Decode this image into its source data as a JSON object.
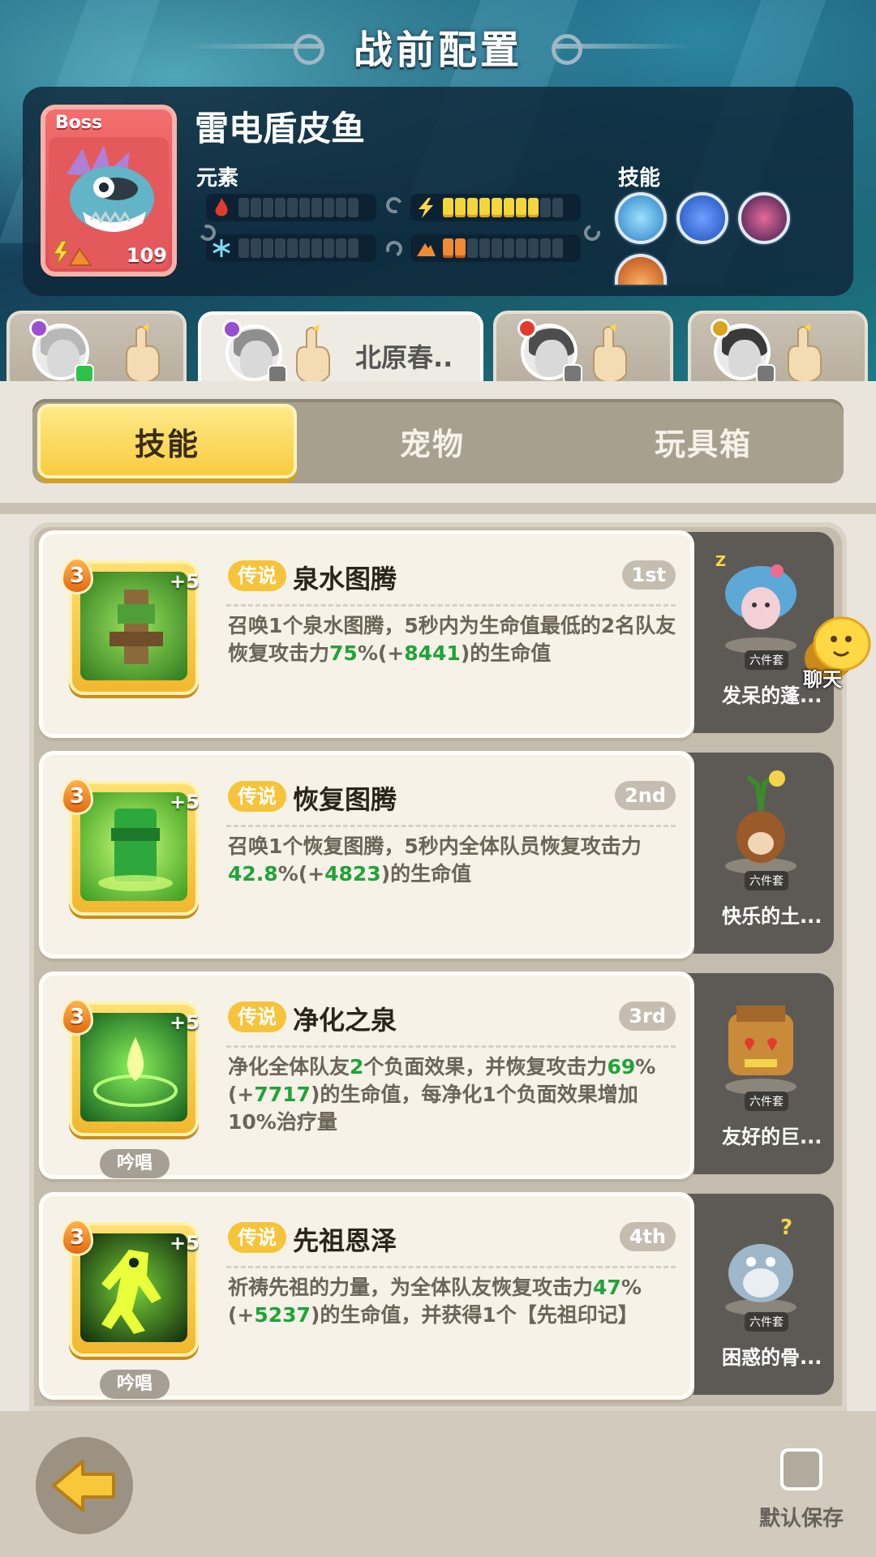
{
  "header": {
    "title": "战前配置"
  },
  "boss": {
    "tag": "Boss",
    "level": "109",
    "name": "雷电盾皮鱼",
    "element_label": "元素",
    "skill_label": "技能",
    "elements": [
      {
        "icon": "fire-icon",
        "filled": 0,
        "total": 10
      },
      {
        "icon": "lightning-icon",
        "filled": 8,
        "total": 10
      },
      {
        "icon": "ice-icon",
        "filled": 0,
        "total": 10
      },
      {
        "icon": "earth-icon",
        "filled": 2,
        "total": 10
      }
    ]
  },
  "char_tabs": [
    {
      "name": "",
      "active": false
    },
    {
      "name": "北原春..",
      "active": true
    },
    {
      "name": "",
      "active": false
    },
    {
      "name": "",
      "active": false
    }
  ],
  "tabs": [
    {
      "label": "技能",
      "active": true
    },
    {
      "label": "宠物",
      "active": false
    },
    {
      "label": "玩具箱",
      "active": false
    }
  ],
  "skills": [
    {
      "level": "3",
      "plus": "+5",
      "rarity": "传说",
      "title": "泉水图腾",
      "order": "1st",
      "desc_parts": [
        "召唤1个泉水图腾，5秒内为生命值最低的2名队友恢复攻击力",
        "75",
        "%(+",
        "8441",
        ")的生命值"
      ],
      "chant": "",
      "pet": {
        "name": "发呆的蓬...",
        "tag": "六件套"
      }
    },
    {
      "level": "3",
      "plus": "+5",
      "rarity": "传说",
      "title": "恢复图腾",
      "order": "2nd",
      "desc_parts": [
        "召唤1个恢复图腾，5秒内全体队员恢复攻击力",
        "42.8",
        "%(+",
        "4823",
        ")的生命值"
      ],
      "chant": "",
      "pet": {
        "name": "快乐的土...",
        "tag": "六件套"
      }
    },
    {
      "level": "3",
      "plus": "+5",
      "rarity": "传说",
      "title": "净化之泉",
      "order": "3rd",
      "desc_parts": [
        "净化全体队友",
        "2",
        "个负面效果，并恢复攻击力",
        "69",
        "%(+",
        "7717",
        ")的生命值，每净化1个负面效果增加10%治疗量"
      ],
      "chant": "吟唱",
      "pet": {
        "name": "友好的巨...",
        "tag": "六件套"
      }
    },
    {
      "level": "3",
      "plus": "+5",
      "rarity": "传说",
      "title": "先祖恩泽",
      "order": "4th",
      "desc_parts": [
        "祈祷先祖的力量，为全体队友恢复攻击力",
        "47",
        "%(+",
        "5237",
        ")的生命值，并获得1个【先祖印记】"
      ],
      "chant": "吟唱",
      "pet": {
        "name": "困惑的骨...",
        "tag": "六件套"
      }
    }
  ],
  "chat": {
    "label": "聊天"
  },
  "footer": {
    "save_label": "默认保存"
  },
  "colors": {
    "accent": "#f8cc3f",
    "highlight_green": "#22a33a",
    "rarity": "#f6c43a"
  }
}
